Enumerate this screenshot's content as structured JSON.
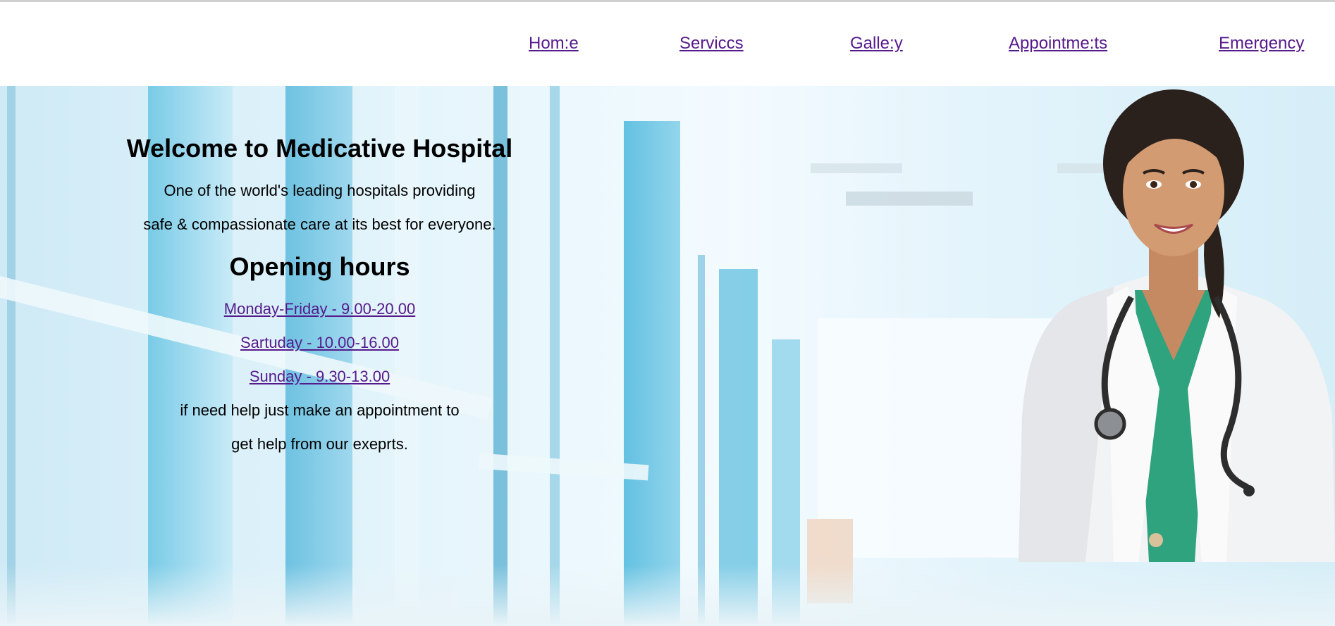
{
  "nav": {
    "items": [
      {
        "label": "Hom:e"
      },
      {
        "label": "Serviccs"
      },
      {
        "label": "Galle:y"
      },
      {
        "label": "Appointme:ts"
      },
      {
        "label": "Emergency"
      }
    ],
    "link_color": "#551a8b"
  },
  "hero": {
    "title": "Welcome to Medicative Hospital",
    "intro_lines": [
      "One of the world's leading hospitals providing",
      "safe & compassionate care at its best for everyone."
    ],
    "hours_title": "Opening hours",
    "hours": [
      "Monday-Friday - 9.00-20.00",
      "Sartuday - 10.00-16.00",
      "Sunday - 9.30-13.00"
    ],
    "help_lines": [
      "if need help just make an appointment to",
      "get help from our exeprts."
    ]
  },
  "images": {
    "background": "hospital-corridor-photo",
    "doctor": "female-doctor-photo"
  }
}
